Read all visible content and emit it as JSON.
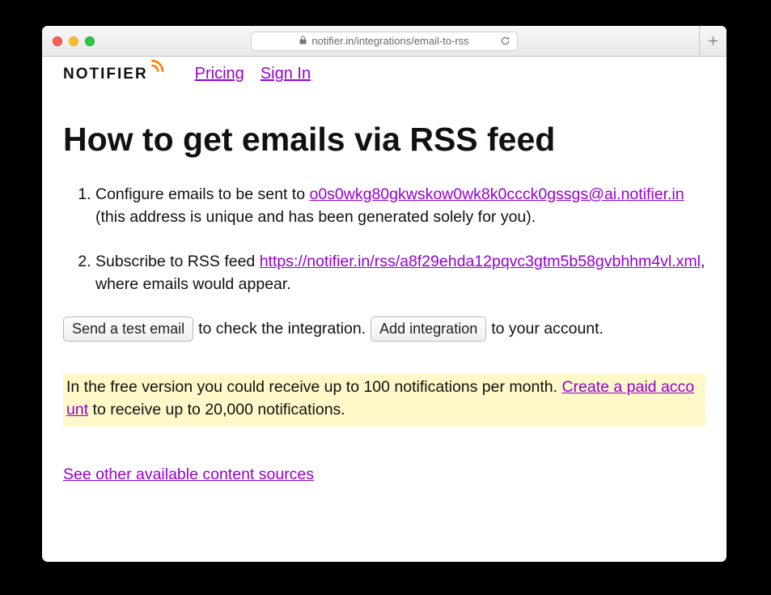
{
  "browser": {
    "url": "notifier.in/integrations/email-to-rss"
  },
  "header": {
    "logo_text": "NOTIFIER",
    "nav": {
      "pricing": "Pricing",
      "sign_in": "Sign In"
    }
  },
  "page": {
    "title": "How to get emails via RSS feed",
    "step1": {
      "prefix": "Configure emails to be sent to ",
      "email": "o0s0wkg80gkwskow0wk8k0ccck0gssgs@ai.notifier.in",
      "suffix": " (this address is unique and has been generated solely for you)."
    },
    "step2": {
      "prefix": "Subscribe to RSS feed ",
      "url": "https://notifier.in/rss/a8f29ehda12pqvc3gtm5b58gvbhhm4vl.xml",
      "suffix": ", where emails would appear."
    },
    "actions": {
      "send_test_label": "Send a test email",
      "send_test_after": " to check the integration. ",
      "add_integration_label": "Add integration",
      "add_integration_after": " to your account."
    },
    "notice": {
      "before": "In the free version you could receive up to 100 notifications per month. ",
      "link": "Create a paid account",
      "after": " to receive up to 20,000 notifications."
    },
    "footer": {
      "other_sources": "See other available content sources"
    }
  }
}
